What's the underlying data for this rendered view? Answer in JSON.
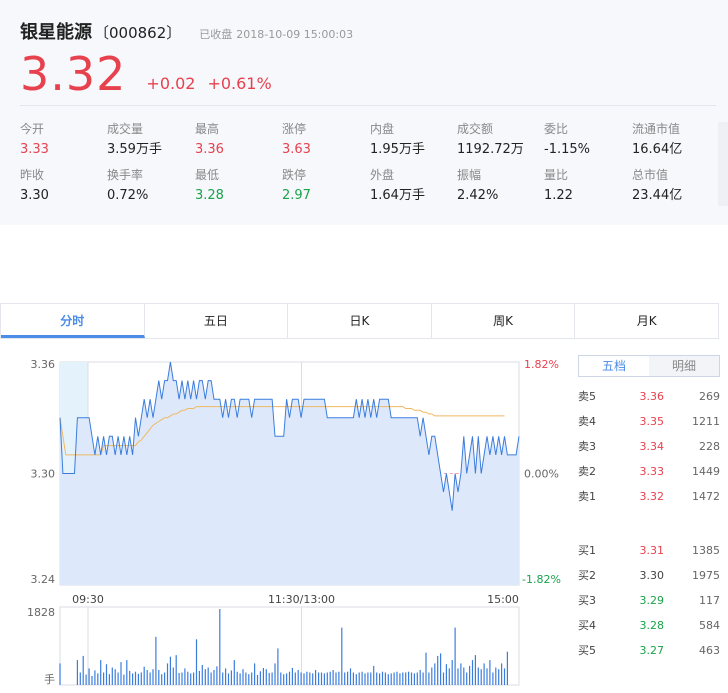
{
  "stock": {
    "name": "银星能源",
    "code": "〔000862〕",
    "status": "已收盘",
    "time": "2018-10-09  15:00:03",
    "price": "3.32",
    "change": "+0.02",
    "change_pct": "+0.61%"
  },
  "stats": [
    {
      "label": "今开",
      "value": "3.33",
      "color": "red"
    },
    {
      "label": "成交量",
      "value": "3.59万手",
      "color": ""
    },
    {
      "label": "最高",
      "value": "3.36",
      "color": "red"
    },
    {
      "label": "涨停",
      "value": "3.63",
      "color": "red"
    },
    {
      "label": "内盘",
      "value": "1.95万手",
      "color": ""
    },
    {
      "label": "成交额",
      "value": "1192.72万",
      "color": ""
    },
    {
      "label": "委比",
      "value": "-1.15%",
      "color": ""
    },
    {
      "label": "流通市值",
      "value": "16.64亿",
      "color": ""
    },
    {
      "label": "昨收",
      "value": "3.30",
      "color": ""
    },
    {
      "label": "换手率",
      "value": "0.72%",
      "color": ""
    },
    {
      "label": "最低",
      "value": "3.28",
      "color": "green"
    },
    {
      "label": "跌停",
      "value": "2.97",
      "color": "green"
    },
    {
      "label": "外盘",
      "value": "1.64万手",
      "color": ""
    },
    {
      "label": "振幅",
      "value": "2.42%",
      "color": ""
    },
    {
      "label": "量比",
      "value": "1.22",
      "color": ""
    },
    {
      "label": "总市值",
      "value": "23.44亿",
      "color": ""
    }
  ],
  "tabs": [
    "分时",
    "五日",
    "日K",
    "周K",
    "月K"
  ],
  "panel_tabs": [
    "五档",
    "明细"
  ],
  "order_book": {
    "asks": [
      {
        "name": "卖5",
        "price": "3.36",
        "vol": "269"
      },
      {
        "name": "卖4",
        "price": "3.35",
        "vol": "1211"
      },
      {
        "name": "卖3",
        "price": "3.34",
        "vol": "228"
      },
      {
        "name": "卖2",
        "price": "3.33",
        "vol": "1449"
      },
      {
        "name": "卖1",
        "price": "3.32",
        "vol": "1472"
      }
    ],
    "bids": [
      {
        "name": "买1",
        "price": "3.31",
        "vol": "1385"
      },
      {
        "name": "买2",
        "price": "3.30",
        "vol": "1975"
      },
      {
        "name": "买3",
        "price": "3.29",
        "vol": "117"
      },
      {
        "name": "买4",
        "price": "3.28",
        "vol": "584"
      },
      {
        "name": "买5",
        "price": "3.27",
        "vol": "463"
      }
    ]
  },
  "colors": {
    "up": "#e8414e",
    "down": "#1aa34a",
    "price_line": "#3b7ddd",
    "avg_line": "#f0b860",
    "fill": "#dde9fb",
    "accent": "#4a8ce8"
  },
  "chart_data": {
    "type": "line",
    "x_ticks": [
      "09:30",
      "11:30/13:00",
      "15:00"
    ],
    "y_ticks_left": [
      "3.36",
      "3.30",
      "3.24"
    ],
    "y_ticks_right": [
      "1.82%",
      "0.00%",
      "-1.82%"
    ],
    "ylim": [
      3.24,
      3.36
    ],
    "prev_close": 3.3,
    "vol_max_label": "1828",
    "vol_unit": "手",
    "price": [
      3.33,
      3.3,
      3.3,
      3.3,
      3.3,
      3.3,
      3.33,
      3.33,
      3.33,
      3.33,
      3.33,
      3.32,
      3.31,
      3.32,
      3.31,
      3.32,
      3.31,
      3.32,
      3.32,
      3.31,
      3.32,
      3.31,
      3.32,
      3.31,
      3.32,
      3.31,
      3.33,
      3.32,
      3.33,
      3.34,
      3.33,
      3.34,
      3.33,
      3.34,
      3.35,
      3.34,
      3.35,
      3.35,
      3.36,
      3.35,
      3.35,
      3.34,
      3.35,
      3.34,
      3.35,
      3.34,
      3.35,
      3.34,
      3.35,
      3.35,
      3.34,
      3.35,
      3.35,
      3.34,
      3.34,
      3.34,
      3.33,
      3.34,
      3.33,
      3.34,
      3.34,
      3.33,
      3.34,
      3.34,
      3.34,
      3.34,
      3.33,
      3.34,
      3.34,
      3.34,
      3.34,
      3.34,
      3.34,
      3.34,
      3.32,
      3.32,
      3.32,
      3.32,
      3.34,
      3.33,
      3.34,
      3.34,
      3.34,
      3.33,
      3.34,
      3.34,
      3.34,
      3.34,
      3.34,
      3.34,
      3.34,
      3.34,
      3.33,
      3.33,
      3.33,
      3.33,
      3.33,
      3.33,
      3.33,
      3.33,
      3.33,
      3.33,
      3.34,
      3.33,
      3.34,
      3.33,
      3.34,
      3.33,
      3.34,
      3.33,
      3.34,
      3.34,
      3.34,
      3.34,
      3.33,
      3.33,
      3.33,
      3.33,
      3.33,
      3.33,
      3.33,
      3.33,
      3.33,
      3.33,
      3.32,
      3.33,
      3.32,
      3.31,
      3.32,
      3.32,
      3.31,
      3.3,
      3.29,
      3.3,
      3.29,
      3.28,
      3.3,
      3.29,
      3.3,
      3.32,
      3.3,
      3.31,
      3.32,
      3.3,
      3.32,
      3.3,
      3.31,
      3.32,
      3.31,
      3.32,
      3.31,
      3.32,
      3.31,
      3.32,
      3.31,
      3.31,
      3.31,
      3.31,
      3.32
    ],
    "avg": [
      3.33,
      3.32,
      3.31,
      3.31,
      3.31,
      3.31,
      3.31,
      3.31,
      3.31,
      3.31,
      3.31,
      3.31,
      3.31,
      3.31,
      3.31,
      3.315,
      3.315,
      3.315,
      3.315,
      3.315,
      3.315,
      3.315,
      3.315,
      3.315,
      3.315,
      3.315,
      3.315,
      3.317,
      3.318,
      3.32,
      3.322,
      3.324,
      3.326,
      3.327,
      3.328,
      3.329,
      3.33,
      3.33,
      3.331,
      3.332,
      3.332,
      3.333,
      3.334,
      3.334,
      3.335,
      3.335,
      3.335,
      3.336,
      3.336,
      3.336,
      3.336,
      3.336,
      3.336,
      3.336,
      3.336,
      3.336,
      3.336,
      3.336,
      3.336,
      3.336,
      3.336,
      3.336,
      3.336,
      3.336,
      3.336,
      3.336,
      3.336,
      3.336,
      3.336,
      3.336,
      3.336,
      3.336,
      3.336,
      3.336,
      3.336,
      3.336,
      3.336,
      3.336,
      3.336,
      3.336,
      3.336,
      3.336,
      3.336,
      3.336,
      3.336,
      3.336,
      3.336,
      3.336,
      3.336,
      3.336,
      3.336,
      3.336,
      3.336,
      3.336,
      3.336,
      3.336,
      3.336,
      3.336,
      3.336,
      3.336,
      3.336,
      3.336,
      3.336,
      3.336,
      3.336,
      3.336,
      3.336,
      3.336,
      3.336,
      3.336,
      3.336,
      3.336,
      3.336,
      3.336,
      3.336,
      3.336,
      3.336,
      3.336,
      3.336,
      3.335,
      3.335,
      3.335,
      3.334,
      3.334,
      3.334,
      3.333,
      3.333,
      3.332,
      3.332,
      3.331,
      3.331,
      3.331,
      3.331,
      3.331,
      3.331,
      3.331,
      3.331,
      3.331,
      3.331,
      3.331,
      3.331,
      3.331,
      3.331,
      3.331,
      3.331,
      3.331,
      3.331,
      3.331,
      3.331,
      3.331,
      3.331,
      3.331,
      3.331,
      3.331
    ],
    "volume": [
      520,
      0,
      0,
      0,
      0,
      0,
      600,
      300,
      700,
      250,
      400,
      220,
      350,
      280,
      600,
      300,
      500,
      260,
      420,
      380,
      300,
      550,
      250,
      600,
      340,
      280,
      320,
      270,
      300,
      440,
      360,
      300,
      380,
      1160,
      360,
      260,
      300,
      520,
      680,
      420,
      720,
      290,
      300,
      400,
      320,
      280,
      300,
      1100,
      340,
      480,
      380,
      420,
      300,
      360,
      450,
      1828,
      300,
      400,
      280,
      350,
      600,
      320,
      280,
      380,
      300,
      260,
      300,
      520,
      240,
      330,
      410,
      380,
      290,
      300,
      520,
      880,
      300,
      260,
      280,
      320,
      410,
      300,
      360,
      300,
      280,
      320,
      300,
      280,
      360,
      300,
      300,
      280,
      300,
      320,
      360,
      300,
      320,
      1380,
      300,
      320,
      400,
      300,
      260,
      300,
      320,
      280,
      300,
      300,
      460,
      300,
      280,
      320,
      300,
      260,
      280,
      300,
      320,
      280,
      300,
      300,
      320,
      300,
      280,
      300,
      360,
      300,
      780,
      300,
      420,
      520,
      700,
      760,
      300,
      500,
      400,
      600,
      1380,
      400,
      520,
      420,
      300,
      460,
      600,
      720,
      420,
      380,
      520,
      400,
      600,
      300,
      420,
      380,
      520,
      400,
      800
    ]
  }
}
